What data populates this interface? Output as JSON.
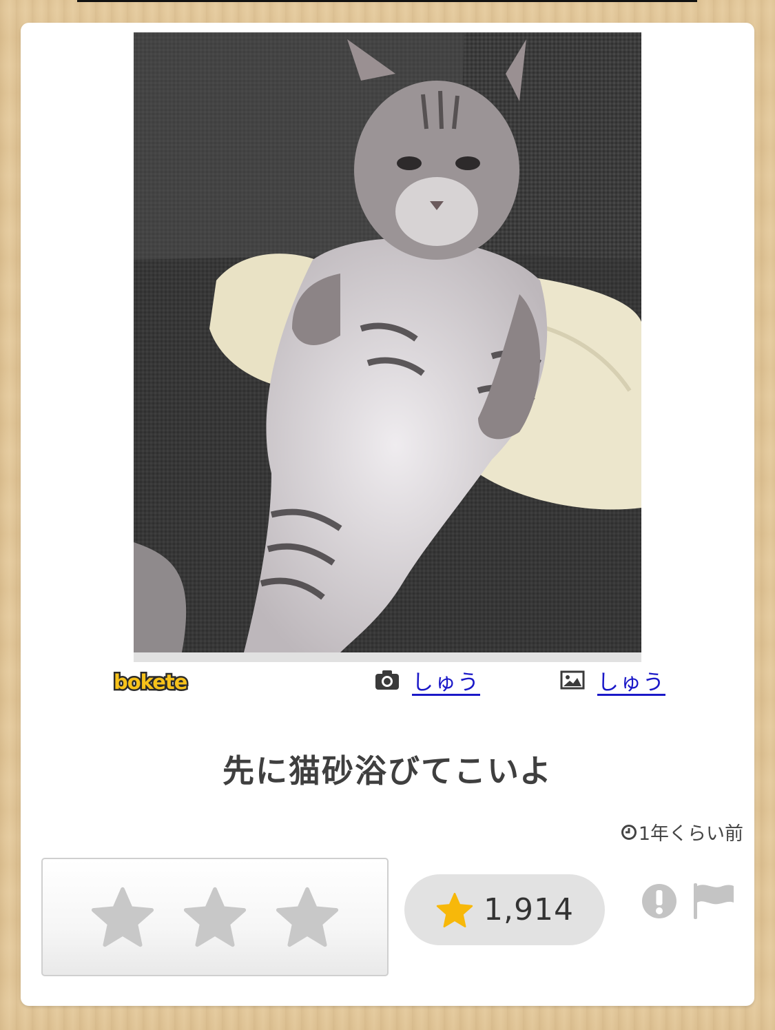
{
  "post": {
    "brand": "bokete",
    "photo_credit": "しゅう",
    "image_credit": "しゅう",
    "caption": "先に猫砂浴びてこいよ",
    "posted": "1年くらい前",
    "star_rating": 1914,
    "star_count_label": "1,914"
  },
  "icons": {
    "photo": "camera-icon",
    "image": "image-icon",
    "time": "clock-icon",
    "rate": "star-icon",
    "report": "alert-icon",
    "flag": "flag-icon"
  },
  "colors": {
    "background": "#e3c89a",
    "link": "#1a18c8",
    "star_filled": "#f7b80a",
    "star_empty": "#c8c8c8",
    "pill": "#e2e2e2"
  }
}
